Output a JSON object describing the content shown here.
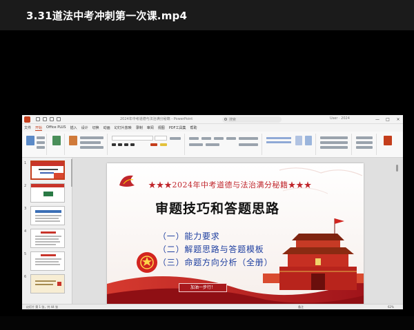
{
  "player": {
    "title": "3.31道法中考冲刺第一次课.mp4"
  },
  "powerpoint": {
    "document_title": "2024年中考道德与法治满分秘籍 - PowerPoint",
    "search_label": "搜索",
    "account_label": "User · 2024",
    "window_controls": [
      "—",
      "□",
      "×"
    ],
    "tabs": [
      "文件",
      "开始",
      "Office PLUS",
      "插入",
      "设计",
      "切换",
      "动画",
      "幻灯片放映",
      "录制",
      "审阅",
      "视图",
      "PDF工具集",
      "帮助"
    ],
    "active_tab": "开始"
  },
  "slide": {
    "banner": "★★★2024年中考道德与法治满分秘籍★★★",
    "heading": "审题技巧和答题思路",
    "items": [
      "（一）能力要求",
      "（二）解题思路与答题模板",
      "（三）命题方向分析（全册）"
    ],
    "button": "加油一步行！"
  },
  "thumbnails": [
    {
      "num": "1"
    },
    {
      "num": "2"
    },
    {
      "num": "3"
    },
    {
      "num": "4"
    },
    {
      "num": "5"
    },
    {
      "num": "6"
    }
  ],
  "status": {
    "slide_info": "幻灯片 第 1 张，共 44 张",
    "notes": "备注",
    "zoom": "62%"
  },
  "colors": {
    "ppt_accent": "#c43e1c",
    "slide_red": "#c0262c",
    "slide_blue": "#1e3fa0"
  }
}
